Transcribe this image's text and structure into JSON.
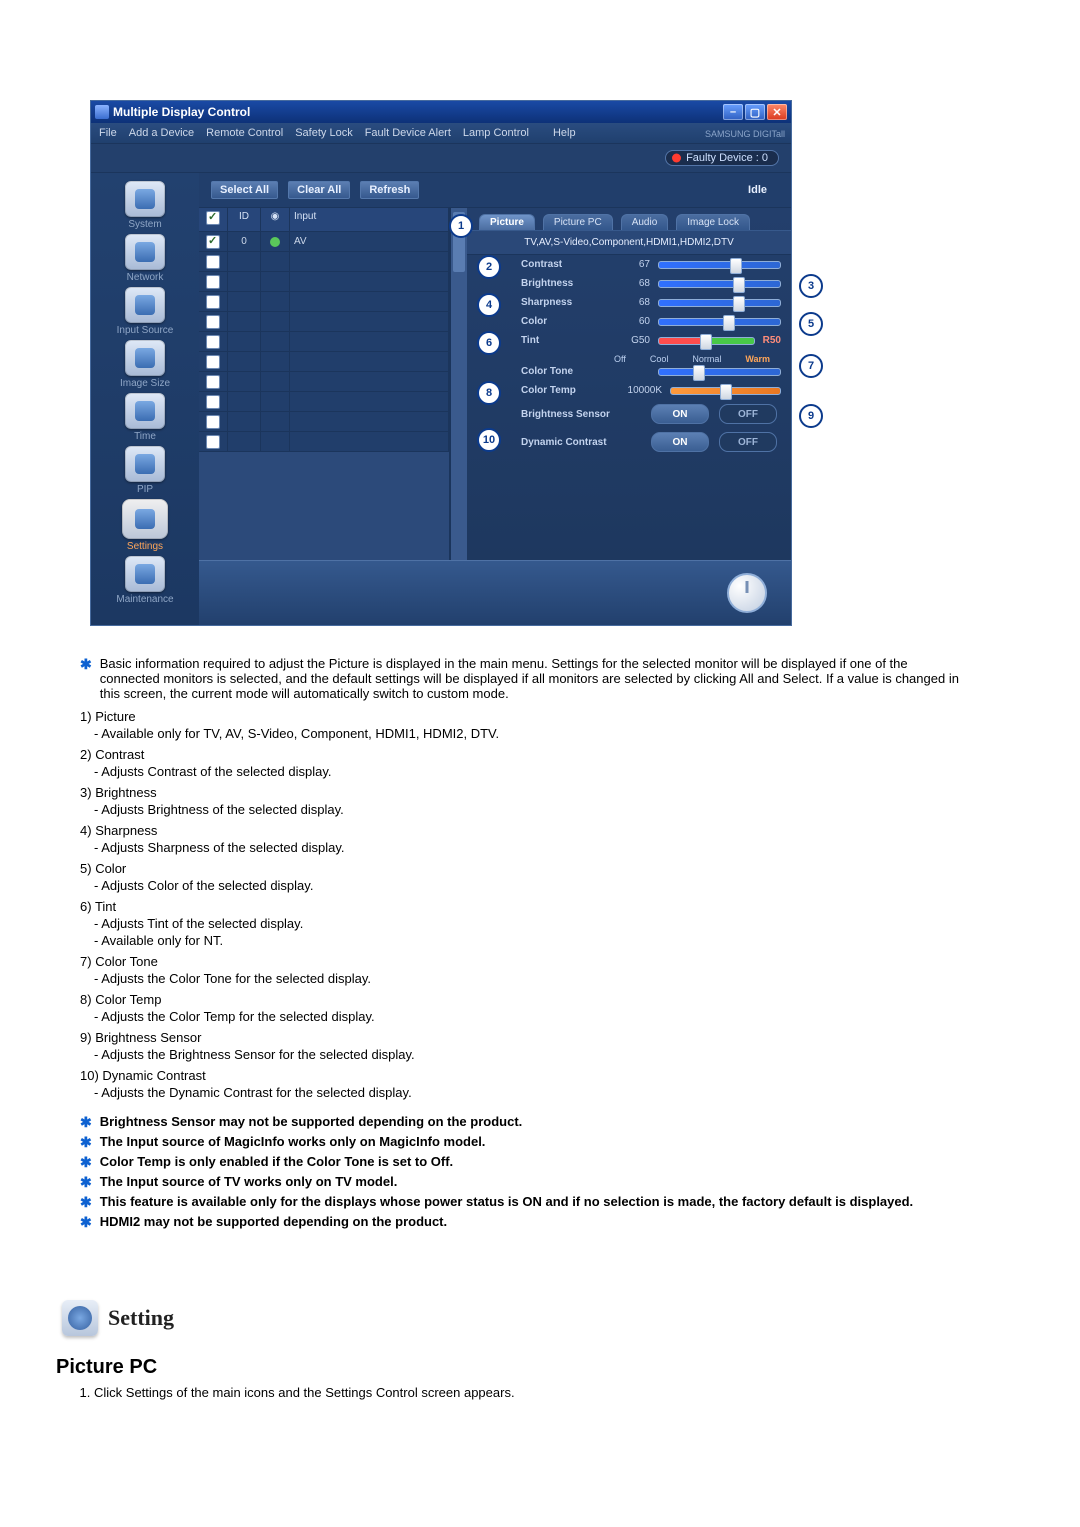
{
  "app": {
    "title": "Multiple Display Control",
    "menubar": [
      "File",
      "Add a Device",
      "Remote Control",
      "Safety Lock",
      "Fault Device Alert",
      "Lamp Control",
      "Help"
    ],
    "logo_text": "SAMSUNG DIGITall",
    "faulty_device_text": "Faulty Device : 0",
    "toolbar": {
      "select_all": "Select All",
      "clear_all": "Clear All",
      "refresh": "Refresh",
      "idle": "Idle"
    },
    "sidebar": [
      {
        "label": "System"
      },
      {
        "label": "Network"
      },
      {
        "label": "Input Source"
      },
      {
        "label": "Image Size"
      },
      {
        "label": "Time"
      },
      {
        "label": "PIP"
      },
      {
        "label": "Settings"
      },
      {
        "label": "Maintenance"
      }
    ],
    "device_table": {
      "headers": {
        "id": "ID",
        "input": "Input"
      },
      "first_row": {
        "checked": true,
        "id": "0",
        "status": "green",
        "input": "AV"
      }
    },
    "tabs": [
      "Picture",
      "Picture PC",
      "Audio",
      "Image Lock"
    ],
    "selected_tab": 0,
    "source_note": "TV,AV,S-Video,Component,HDMI1,HDMI2,DTV",
    "params": {
      "contrast": {
        "label": "Contrast",
        "value": "67",
        "pos": 64
      },
      "brightness": {
        "label": "Brightness",
        "value": "68",
        "pos": 66
      },
      "sharpness": {
        "label": "Sharpness",
        "value": "68",
        "pos": 66
      },
      "color": {
        "label": "Color",
        "value": "60",
        "pos": 58
      },
      "tint": {
        "label": "Tint",
        "value": "G50",
        "pos": 50,
        "right": "R50",
        "right_text": "R50"
      },
      "color_tone": {
        "label": "Color Tone",
        "options": [
          "Off",
          "Cool",
          "Normal",
          "Warm"
        ],
        "pos": 33
      },
      "color_temp": {
        "label": "Color Temp",
        "value": "10000K",
        "pos": 50
      },
      "brightness_sensor": {
        "label": "Brightness Sensor",
        "on": "ON",
        "off": "OFF"
      },
      "dynamic_contrast": {
        "label": "Dynamic Contrast",
        "on": "ON",
        "off": "OFF"
      }
    },
    "callout_numbers": [
      "1",
      "2",
      "3",
      "4",
      "5",
      "6",
      "7",
      "8",
      "9",
      "10"
    ]
  },
  "doc": {
    "intro": "Basic information required to adjust the Picture is displayed in the main menu. Settings for the selected monitor will be displayed if one of the connected monitors is selected, and the default settings will be displayed if all monitors are selected by clicking All and Select. If a value is changed in this screen, the current mode will automatically switch to custom mode.",
    "items": [
      {
        "n": "1)",
        "h": "Picture",
        "subs": [
          "- Available only for TV, AV, S-Video, Component, HDMI1, HDMI2, DTV."
        ]
      },
      {
        "n": "2)",
        "h": "Contrast",
        "subs": [
          "- Adjusts Contrast of the selected display."
        ]
      },
      {
        "n": "3)",
        "h": "Brightness",
        "subs": [
          "- Adjusts Brightness of the selected display."
        ]
      },
      {
        "n": "4)",
        "h": "Sharpness",
        "subs": [
          "- Adjusts Sharpness of the selected display."
        ]
      },
      {
        "n": "5)",
        "h": "Color",
        "subs": [
          "- Adjusts Color of the selected display."
        ]
      },
      {
        "n": "6)",
        "h": "Tint",
        "subs": [
          "- Adjusts Tint of the selected display.",
          "- Available  only for NT."
        ]
      },
      {
        "n": "7)",
        "h": "Color Tone",
        "subs": [
          "- Adjusts the Color Tone for the selected display."
        ]
      },
      {
        "n": "8)",
        "h": "Color Temp",
        "subs": [
          "- Adjusts the Color Temp for the selected display."
        ]
      },
      {
        "n": "9)",
        "h": "Brightness Sensor",
        "subs": [
          "- Adjusts the Brightness Sensor for the selected display."
        ]
      },
      {
        "n": "10)",
        "h": "Dynamic Contrast",
        "subs": [
          "- Adjusts the Dynamic Contrast for the selected display."
        ]
      }
    ],
    "notes": [
      "Brightness Sensor may not be supported depending on the product.",
      "The Input source of MagicInfo works only on MagicInfo model.",
      "Color Temp is only enabled if the Color Tone is set to Off.",
      "The Input source of TV works only on TV model.",
      "This feature is available only for the displays whose power status is ON and if no selection is made, the factory default is displayed.",
      "HDMI2 may not be supported depending on the product."
    ],
    "section_heading": "Setting",
    "subheading": "Picture PC",
    "subitem": "Click Settings of the main icons and the Settings Control screen appears."
  }
}
